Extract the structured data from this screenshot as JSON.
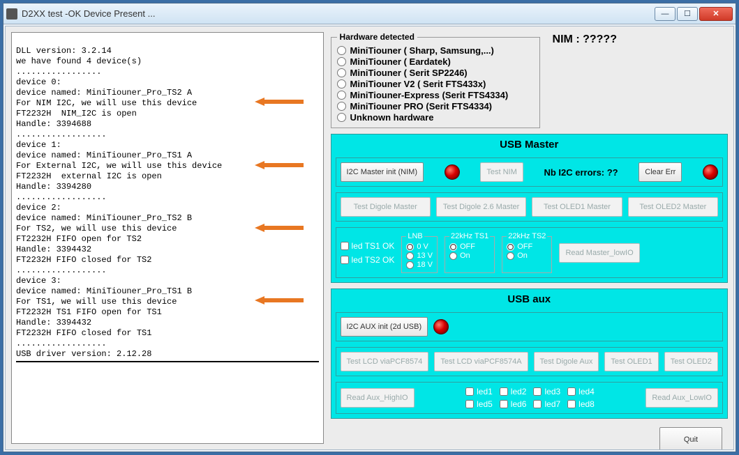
{
  "window": {
    "title": "D2XX test -OK Device Present ..."
  },
  "log": {
    "header": "DLL version: 3.2.14\nwe have found 4 device(s)\n.................",
    "dev0": "device 0:\ndevice named: MiniTiouner_Pro_TS2 A\nFor NIM I2C, we will use this device\nFT2232H  NIM_I2C is open\nHandle: 3394688\n..................",
    "dev1": "device 1:\ndevice named: MiniTiouner_Pro_TS1 A\nFor External I2C, we will use this device\nFT2232H  external I2C is open\nHandle: 3394280\n..................",
    "dev2": "device 2:\ndevice named: MiniTiouner_Pro_TS2 B\nFor TS2, we will use this device\nFT2232H FIFO open for TS2\nHandle: 3394432\nFT2232H FIFO closed for TS2\n..................",
    "dev3": "device 3:\ndevice named: MiniTiouner_Pro_TS1 B\nFor TS1, we will use this device\nFT2232H TS1 FIFO open for TS1\nHandle: 3394432\nFT2232H FIFO closed for TS1\n..................",
    "footer": "USB driver version: 2.12.28"
  },
  "arrows": {
    "color": "#e87722"
  },
  "hardware": {
    "legend": "Hardware detected",
    "options": [
      "MiniTiouner ( Sharp, Samsung,...)",
      "MiniTiouner ( Eardatek)",
      "MiniTiouner ( Serit SP2246)",
      "MiniTiouner V2 ( Serit FTS433x)",
      "MiniTiouner-Express (Serit FTS4334)",
      "MiniTiouner PRO  (Serit FTS4334)",
      "Unknown hardware"
    ]
  },
  "nim": {
    "label": "NIM : ?????"
  },
  "usb_master": {
    "title": "USB Master",
    "i2c_init": "I2C Master init (NIM)",
    "test_nim": "Test NIM",
    "errors_label": "Nb I2C errors:  ??",
    "clear": "Clear Err",
    "row2": [
      "Test Digole Master",
      "Test Digole 2.6 Master",
      "Test OLED1 Master",
      "Test OLED2 Master"
    ],
    "leds_ts": [
      "led TS1 OK",
      "led TS2 OK"
    ],
    "lnb": {
      "legend": "LNB",
      "opts": [
        "0 V",
        "13 V",
        "18 V"
      ]
    },
    "khz_ts1": {
      "legend": "22kHz TS1",
      "opts": [
        "OFF",
        "On"
      ]
    },
    "khz_ts2": {
      "legend": "22kHz TS2",
      "opts": [
        "OFF",
        "On"
      ]
    },
    "read_master": "Read Master_lowIO"
  },
  "usb_aux": {
    "title": "USB aux",
    "init": "I2C AUX init (2d USB)",
    "row2": [
      "Test LCD viaPCF8574",
      "Test LCD viaPCF8574A",
      "Test Digole Aux",
      "Test OLED1",
      "Test OLED2"
    ],
    "read_high": "Read Aux_HighIO",
    "read_low": "Read Aux_LowIO",
    "leds_a": [
      "led1",
      "led2",
      "led3",
      "led4"
    ],
    "leds_b": [
      "led5",
      "led6",
      "led7",
      "led8"
    ]
  },
  "quit": "Quit"
}
